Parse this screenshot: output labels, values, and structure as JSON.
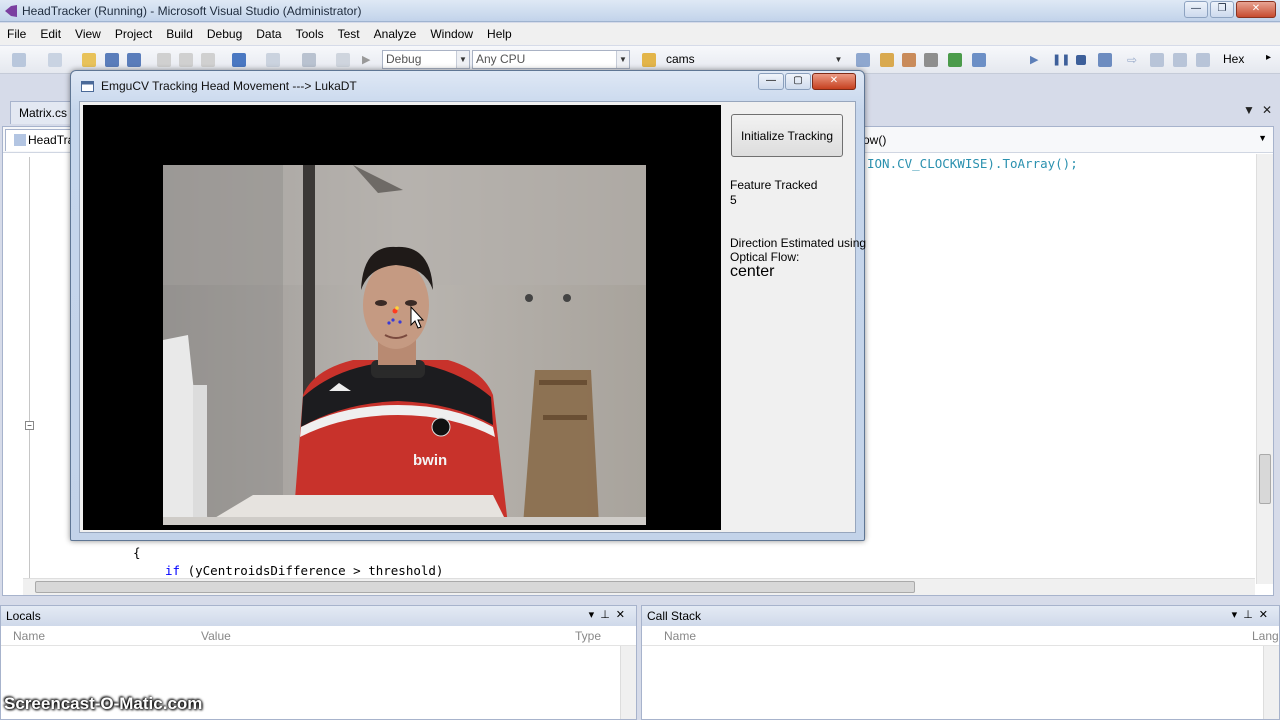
{
  "vs": {
    "title": "HeadTracker (Running) - Microsoft Visual Studio (Administrator)",
    "menu": [
      "File",
      "Edit",
      "View",
      "Project",
      "Build",
      "Debug",
      "Data",
      "Tools",
      "Test",
      "Analyze",
      "Window",
      "Help"
    ],
    "toolbar": {
      "config": "Debug",
      "platform": "Any CPU",
      "find": "cams",
      "hex": "Hex"
    },
    "tabs": {
      "tab1": "Matrix.cs",
      "tab2": "HeadTrack"
    },
    "editor": {
      "nav_right": "ow()",
      "code_top": "ION.CV_CLOCKWISE).ToArray();",
      "code_brace": "{",
      "code_if": "if",
      "code_cond": " (yCentroidsDifference > threshold)"
    },
    "locals": {
      "title": "Locals",
      "col_name": "Name",
      "col_value": "Value",
      "col_type": "Type"
    },
    "callstack": {
      "title": "Call Stack",
      "col_name": "Name",
      "col_lang": "Lang"
    }
  },
  "app": {
    "title": "EmguCV  Tracking Head Movement ---> LukaDT",
    "init_button": "Initialize Tracking",
    "feature_label": "Feature Tracked",
    "feature_count": "5",
    "direction_label_1": "Direction Estimated using",
    "direction_label_2": "Optical Flow:",
    "direction_value": "center"
  },
  "watermark": "Screencast-O-Matic.com"
}
